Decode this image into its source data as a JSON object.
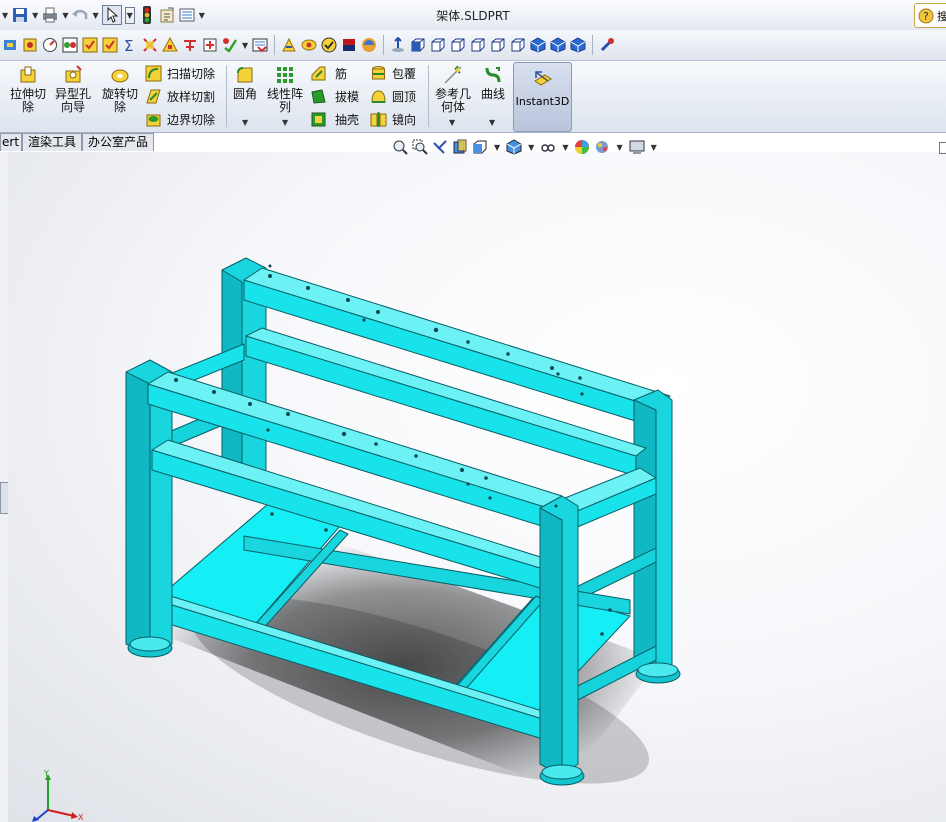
{
  "window": {
    "title": "架体.SLDPRT",
    "help_text": "搜"
  },
  "quick_access": {
    "icons": [
      "new-doc-icon",
      "save-icon",
      "print-icon",
      "undo-icon",
      "select-arrow-icon",
      "rebuild-icon",
      "file-properties-icon",
      "options-icon"
    ]
  },
  "features": {
    "extrude_cut": "拉伸切\n除",
    "hole_wizard": "异型孔\n向导",
    "revolve_cut": "旋转切\n除",
    "swept_cut": "扫描切除",
    "lofted_cut": "放样切割",
    "boundary_cut": "边界切除",
    "fillet": "圆角",
    "linear_pattern": "线性阵\n列",
    "rib": "筋",
    "draft": "拔模",
    "shell": "抽壳",
    "wrap": "包覆",
    "dome": "圆顶",
    "mirror": "镜向",
    "ref_geometry": "参考几\n何体",
    "curves": "曲线",
    "instant3d": "Instant3D"
  },
  "tabs": [
    "ert",
    "渲染工具",
    "办公室产品"
  ],
  "colors": {
    "model": "#18e2ea",
    "model_edge": "#0a5f66",
    "ribbon_active": "#b9c5dc"
  }
}
